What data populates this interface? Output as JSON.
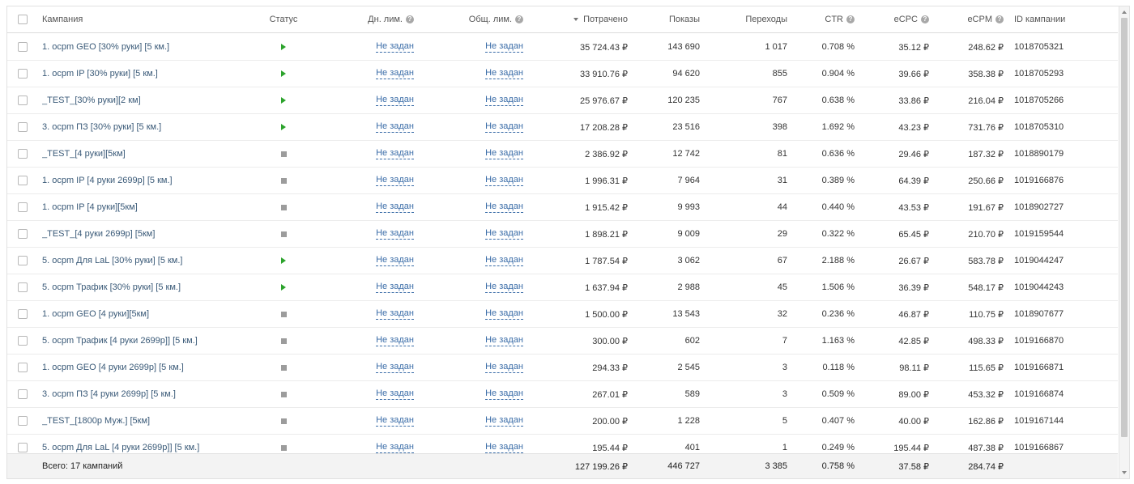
{
  "header": {
    "campaign": "Кампания",
    "status": "Статус",
    "daily_limit": "Дн. лим.",
    "total_limit": "Общ. лим.",
    "spent": "Потрачено",
    "impressions": "Показы",
    "clicks": "Переходы",
    "ctr": "CTR",
    "ecpc": "eCPC",
    "ecpm": "eCPM",
    "campaign_id": "ID кампании"
  },
  "icons": {
    "help": "question-circle-icon",
    "sort": "sort-desc-icon",
    "status_running": "play-icon",
    "status_paused": "stopped-square-icon"
  },
  "colors": {
    "status_running": "#2ca32c",
    "status_paused": "#9c9c9c",
    "link": "#3b6da8"
  },
  "rows": [
    {
      "name": "1. ocpm GEO [30% руки] [5 км.]",
      "status": "active",
      "daily": "Не задан",
      "total": "Не задан",
      "spent": "35 724.43 ₽",
      "impressions": "143 690",
      "clicks": "1 017",
      "ctr": "0.708 %",
      "ecpc": "35.12 ₽",
      "ecpm": "248.62 ₽",
      "id": "1018705321"
    },
    {
      "name": "1. ocpm IP [30% руки] [5 км.]",
      "status": "active",
      "daily": "Не задан",
      "total": "Не задан",
      "spent": "33 910.76 ₽",
      "impressions": "94 620",
      "clicks": "855",
      "ctr": "0.904 %",
      "ecpc": "39.66 ₽",
      "ecpm": "358.38 ₽",
      "id": "1018705293"
    },
    {
      "name": "_TEST_[30% руки][2 км]",
      "status": "active",
      "daily": "Не задан",
      "total": "Не задан",
      "spent": "25 976.67 ₽",
      "impressions": "120 235",
      "clicks": "767",
      "ctr": "0.638 %",
      "ecpc": "33.86 ₽",
      "ecpm": "216.04 ₽",
      "id": "1018705266"
    },
    {
      "name": "3. ocpm ПЗ [30% руки] [5 км.]",
      "status": "active",
      "daily": "Не задан",
      "total": "Не задан",
      "spent": "17 208.28 ₽",
      "impressions": "23 516",
      "clicks": "398",
      "ctr": "1.692 %",
      "ecpc": "43.23 ₽",
      "ecpm": "731.76 ₽",
      "id": "1018705310"
    },
    {
      "name": "_TEST_[4 руки][5км]",
      "status": "paused",
      "daily": "Не задан",
      "total": "Не задан",
      "spent": "2 386.92 ₽",
      "impressions": "12 742",
      "clicks": "81",
      "ctr": "0.636 %",
      "ecpc": "29.46 ₽",
      "ecpm": "187.32 ₽",
      "id": "1018890179"
    },
    {
      "name": "1. ocpm IP [4 руки 2699р] [5 км.]",
      "status": "paused",
      "daily": "Не задан",
      "total": "Не задан",
      "spent": "1 996.31 ₽",
      "impressions": "7 964",
      "clicks": "31",
      "ctr": "0.389 %",
      "ecpc": "64.39 ₽",
      "ecpm": "250.66 ₽",
      "id": "1019166876"
    },
    {
      "name": "1. ocpm IP [4 руки][5км]",
      "status": "paused",
      "daily": "Не задан",
      "total": "Не задан",
      "spent": "1 915.42 ₽",
      "impressions": "9 993",
      "clicks": "44",
      "ctr": "0.440 %",
      "ecpc": "43.53 ₽",
      "ecpm": "191.67 ₽",
      "id": "1018902727"
    },
    {
      "name": "_TEST_[4 руки 2699р] [5км]",
      "status": "paused",
      "daily": "Не задан",
      "total": "Не задан",
      "spent": "1 898.21 ₽",
      "impressions": "9 009",
      "clicks": "29",
      "ctr": "0.322 %",
      "ecpc": "65.45 ₽",
      "ecpm": "210.70 ₽",
      "id": "1019159544"
    },
    {
      "name": "5. ocpm Для LaL [30% руки] [5 км.]",
      "status": "active",
      "daily": "Не задан",
      "total": "Не задан",
      "spent": "1 787.54 ₽",
      "impressions": "3 062",
      "clicks": "67",
      "ctr": "2.188 %",
      "ecpc": "26.67 ₽",
      "ecpm": "583.78 ₽",
      "id": "1019044247"
    },
    {
      "name": "5. ocpm Трафик [30% руки] [5 км.]",
      "status": "active",
      "daily": "Не задан",
      "total": "Не задан",
      "spent": "1 637.94 ₽",
      "impressions": "2 988",
      "clicks": "45",
      "ctr": "1.506 %",
      "ecpc": "36.39 ₽",
      "ecpm": "548.17 ₽",
      "id": "1019044243"
    },
    {
      "name": "1. ocpm GEO [4 руки][5км]",
      "status": "paused",
      "daily": "Не задан",
      "total": "Не задан",
      "spent": "1 500.00 ₽",
      "impressions": "13 543",
      "clicks": "32",
      "ctr": "0.236 %",
      "ecpc": "46.87 ₽",
      "ecpm": "110.75 ₽",
      "id": "1018907677"
    },
    {
      "name": "5. ocpm Трафик [4 руки 2699р]] [5 км.]",
      "status": "paused",
      "daily": "Не задан",
      "total": "Не задан",
      "spent": "300.00 ₽",
      "impressions": "602",
      "clicks": "7",
      "ctr": "1.163 %",
      "ecpc": "42.85 ₽",
      "ecpm": "498.33 ₽",
      "id": "1019166870"
    },
    {
      "name": "1. ocpm GEO [4 руки 2699р] [5 км.]",
      "status": "paused",
      "daily": "Не задан",
      "total": "Не задан",
      "spent": "294.33 ₽",
      "impressions": "2 545",
      "clicks": "3",
      "ctr": "0.118 %",
      "ecpc": "98.11 ₽",
      "ecpm": "115.65 ₽",
      "id": "1019166871"
    },
    {
      "name": "3. ocpm ПЗ [4 руки 2699р] [5 км.]",
      "status": "paused",
      "daily": "Не задан",
      "total": "Не задан",
      "spent": "267.01 ₽",
      "impressions": "589",
      "clicks": "3",
      "ctr": "0.509 %",
      "ecpc": "89.00 ₽",
      "ecpm": "453.32 ₽",
      "id": "1019166874"
    },
    {
      "name": "_TEST_[1800р Муж.] [5км]",
      "status": "paused",
      "daily": "Не задан",
      "total": "Не задан",
      "spent": "200.00 ₽",
      "impressions": "1 228",
      "clicks": "5",
      "ctr": "0.407 %",
      "ecpc": "40.00 ₽",
      "ecpm": "162.86 ₽",
      "id": "1019167144"
    },
    {
      "name": "5. ocpm Для LaL [4 руки 2699р]] [5 км.]",
      "status": "paused",
      "daily": "Не задан",
      "total": "Не задан",
      "spent": "195.44 ₽",
      "impressions": "401",
      "clicks": "1",
      "ctr": "0.249 %",
      "ecpc": "195.44 ₽",
      "ecpm": "487.38 ₽",
      "id": "1019166867"
    }
  ],
  "footer": {
    "label": "Всего: 17 кампаний",
    "spent": "127 199.26 ₽",
    "impressions": "446 727",
    "clicks": "3 385",
    "ctr": "0.758 %",
    "ecpc": "37.58 ₽",
    "ecpm": "284.74 ₽"
  }
}
